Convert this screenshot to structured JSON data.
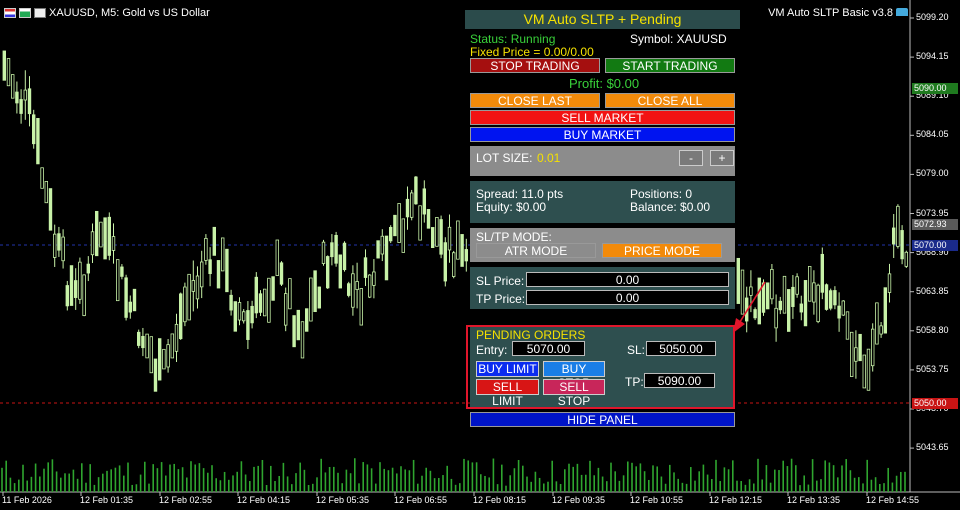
{
  "window": {
    "symbol_caption": "XAUUSD, M5:  Gold vs US Dollar",
    "ea_label": "VM Auto SLTP Basic v3.8"
  },
  "panel": {
    "title": "VM Auto SLTP + Pending",
    "status": "Status: Running",
    "symbol": "Symbol: XAUUSD",
    "fixed_price": "Fixed Price = 0.00/0.00",
    "stop_trading": "STOP TRADING",
    "start_trading": "START TRADING",
    "profit": "Profit: $0.00",
    "close_last": "CLOSE LAST",
    "close_all": "CLOSE ALL",
    "sell_market": "SELL MARKET",
    "buy_market": "BUY MARKET",
    "lot_label": "LOT SIZE:",
    "lot_value": "0.01",
    "minus": "-",
    "plus": "+",
    "spread": "Spread: 11.0 pts",
    "positions": "Positions: 0",
    "equity": "Equity: $0.00",
    "balance": "Balance: $0.00",
    "sltp_mode_label": "SL/TP MODE:",
    "atr_mode": "ATR MODE",
    "price_mode": "PRICE MODE",
    "sl_price_label": "SL Price:",
    "sl_price_value": "0.00",
    "tp_price_label": "TP Price:",
    "tp_price_value": "0.00",
    "pending_title": "PENDING ORDERS",
    "entry_label": "Entry:",
    "entry_value": "5070.00",
    "pending_sl_label": "SL:",
    "pending_sl_value": "5050.00",
    "buy_limit": "BUY LIMIT",
    "buy_stop": "BUY STOP",
    "sell_limit": "SELL LIMIT",
    "sell_stop": "SELL STOP",
    "pending_tp_label": "TP:",
    "pending_tp_value": "5090.00",
    "hide_panel": "HIDE PANEL"
  },
  "price_axis": {
    "labels": [
      "5099.20",
      "5094.15",
      "5089.10",
      "5084.05",
      "5079.00",
      "5073.95",
      "5068.90",
      "5063.85",
      "5058.80",
      "5053.75",
      "5048.70",
      "5043.65"
    ],
    "tags": [
      {
        "text": "5090.00",
        "color": "#1f7a1f"
      },
      {
        "text": "5072.93",
        "color": "#5a5a5a"
      },
      {
        "text": "5070.00",
        "color": "#1a2a8a"
      },
      {
        "text": "5050.00",
        "color": "#c81414"
      }
    ]
  },
  "time_axis": {
    "labels": [
      "11 Feb 2026",
      "12 Feb 01:35",
      "12 Feb 02:55",
      "12 Feb 04:15",
      "12 Feb 05:35",
      "12 Feb 06:55",
      "12 Feb 08:15",
      "12 Feb 09:35",
      "12 Feb 10:55",
      "12 Feb 12:15",
      "12 Feb 13:35",
      "12 Feb 14:55"
    ]
  },
  "colors": {
    "candle": "#c8f2a8",
    "panel_bg": "#2e4f4f",
    "stop": "#a50f0f",
    "start": "#127a12",
    "orange": "#f28a0a",
    "sell": "#f21212",
    "buy": "#0014f0"
  }
}
